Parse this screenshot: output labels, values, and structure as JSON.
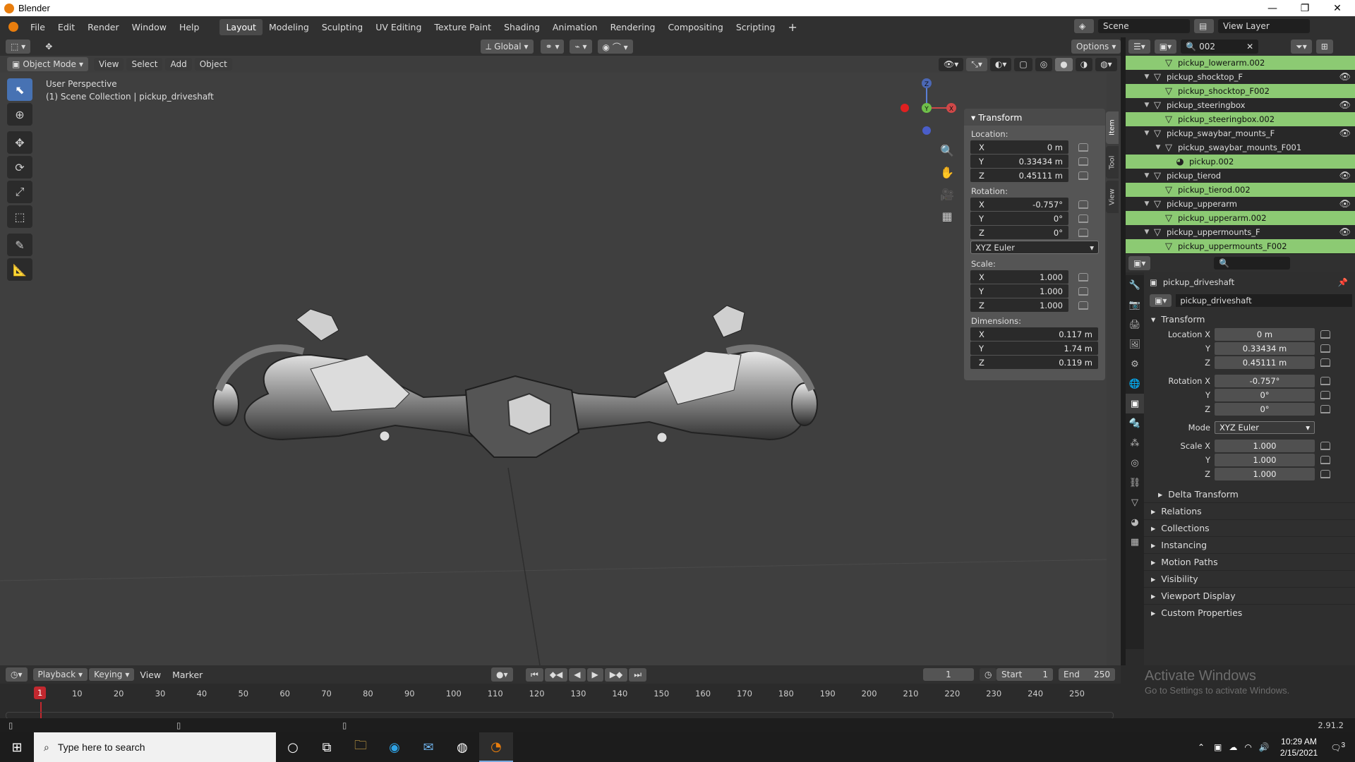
{
  "window": {
    "title": "Blender",
    "min": "—",
    "max": "❐",
    "close": "✕"
  },
  "menus": [
    "File",
    "Edit",
    "Render",
    "Window",
    "Help"
  ],
  "workspaces": [
    "Layout",
    "Modeling",
    "Sculpting",
    "UV Editing",
    "Texture Paint",
    "Shading",
    "Animation",
    "Rendering",
    "Compositing",
    "Scripting"
  ],
  "workspace_add": "+",
  "scene": {
    "scene_name": "Scene",
    "view_layer": "View Layer",
    "search": "002"
  },
  "viewport": {
    "transform_orientation": "Global",
    "options": "Options",
    "mode": "Object Mode",
    "menus": [
      "View",
      "Select",
      "Add",
      "Object"
    ],
    "info_line1": "User Perspective",
    "info_line2": "(1) Scene Collection | pickup_driveshaft",
    "gizmo": {
      "z": "Z",
      "y": "Y",
      "x": "X"
    }
  },
  "npanel": {
    "title": "Transform",
    "location_label": "Location:",
    "location": [
      {
        "axis": "X",
        "value": "0 m"
      },
      {
        "axis": "Y",
        "value": "0.33434 m"
      },
      {
        "axis": "Z",
        "value": "0.45111 m"
      }
    ],
    "rotation_label": "Rotation:",
    "rotation": [
      {
        "axis": "X",
        "value": "-0.757°"
      },
      {
        "axis": "Y",
        "value": "0°"
      },
      {
        "axis": "Z",
        "value": "0°"
      }
    ],
    "rotation_mode": "XYZ Euler",
    "scale_label": "Scale:",
    "scale": [
      {
        "axis": "X",
        "value": "1.000"
      },
      {
        "axis": "Y",
        "value": "1.000"
      },
      {
        "axis": "Z",
        "value": "1.000"
      }
    ],
    "dimensions_label": "Dimensions:",
    "dimensions": [
      {
        "axis": "X",
        "value": "0.117 m"
      },
      {
        "axis": "Y",
        "value": "1.74 m"
      },
      {
        "axis": "Z",
        "value": "0.119 m"
      }
    ],
    "tabs": [
      "Item",
      "Tool",
      "View"
    ]
  },
  "outliner": {
    "rows": [
      {
        "label": "pickup_lowerarm.002",
        "indent": 2,
        "kind": "mesh",
        "sel": true,
        "eye": false,
        "tri": ""
      },
      {
        "label": "pickup_shocktop_F",
        "indent": 1,
        "kind": "object",
        "sel": false,
        "eye": true,
        "tri": "▼"
      },
      {
        "label": "pickup_shocktop_F002",
        "indent": 2,
        "kind": "mesh",
        "sel": true,
        "eye": false,
        "tri": ""
      },
      {
        "label": "pickup_steeringbox",
        "indent": 1,
        "kind": "object",
        "sel": false,
        "eye": true,
        "tri": "▼"
      },
      {
        "label": "pickup_steeringbox.002",
        "indent": 2,
        "kind": "mesh",
        "sel": true,
        "eye": false,
        "tri": ""
      },
      {
        "label": "pickup_swaybar_mounts_F",
        "indent": 1,
        "kind": "object",
        "sel": false,
        "eye": true,
        "tri": "▼"
      },
      {
        "label": "pickup_swaybar_mounts_F001",
        "indent": 2,
        "kind": "mesh",
        "sel": false,
        "eye": false,
        "tri": "▼"
      },
      {
        "label": "pickup.002",
        "indent": 3,
        "kind": "material",
        "sel": true,
        "eye": false,
        "tri": ""
      },
      {
        "label": "pickup_tierod",
        "indent": 1,
        "kind": "object",
        "sel": false,
        "eye": true,
        "tri": "▼"
      },
      {
        "label": "pickup_tierod.002",
        "indent": 2,
        "kind": "mesh",
        "sel": true,
        "eye": false,
        "tri": ""
      },
      {
        "label": "pickup_upperarm",
        "indent": 1,
        "kind": "object",
        "sel": false,
        "eye": true,
        "tri": "▼"
      },
      {
        "label": "pickup_upperarm.002",
        "indent": 2,
        "kind": "mesh",
        "sel": true,
        "eye": false,
        "tri": ""
      },
      {
        "label": "pickup_uppermounts_F",
        "indent": 1,
        "kind": "object",
        "sel": false,
        "eye": true,
        "tri": "▼"
      },
      {
        "label": "pickup_uppermounts_F002",
        "indent": 2,
        "kind": "mesh",
        "sel": true,
        "eye": false,
        "tri": ""
      }
    ]
  },
  "properties": {
    "object_name": "pickup_driveshaft",
    "object_field": "pickup_driveshaft",
    "section": "Transform",
    "rows": [
      {
        "label": "Location X",
        "value": "0 m"
      },
      {
        "label": "Y",
        "value": "0.33434 m"
      },
      {
        "label": "Z",
        "value": "0.45111 m"
      },
      {
        "label": "Rotation X",
        "value": "-0.757°"
      },
      {
        "label": "Y",
        "value": "0°"
      },
      {
        "label": "Z",
        "value": "0°"
      }
    ],
    "mode_label": "Mode",
    "mode_value": "XYZ Euler",
    "scale_rows": [
      {
        "label": "Scale X",
        "value": "1.000"
      },
      {
        "label": "Y",
        "value": "1.000"
      },
      {
        "label": "Z",
        "value": "1.000"
      }
    ],
    "delta": "Delta Transform",
    "collapsed": [
      "Relations",
      "Collections",
      "Instancing",
      "Motion Paths",
      "Visibility",
      "Viewport Display",
      "Custom Properties"
    ]
  },
  "timeline": {
    "menus": [
      "Playback",
      "Keying",
      "View",
      "Marker"
    ],
    "current_frame": "1",
    "start_label": "Start",
    "start": "1",
    "end_label": "End",
    "end": "250",
    "ticks": [
      "10",
      "20",
      "30",
      "40",
      "50",
      "60",
      "70",
      "80",
      "90",
      "100",
      "110",
      "120",
      "130",
      "140",
      "150",
      "160",
      "170",
      "180",
      "190",
      "200",
      "210",
      "220",
      "230",
      "240",
      "250"
    ],
    "playhead": "1"
  },
  "status": {
    "version": "2.91.2",
    "activate1": "Activate Windows",
    "activate2": "Go to Settings to activate Windows."
  },
  "taskbar": {
    "search_placeholder": "Type here to search",
    "time": "10:29 AM",
    "date": "2/15/2021",
    "notif": "3"
  }
}
